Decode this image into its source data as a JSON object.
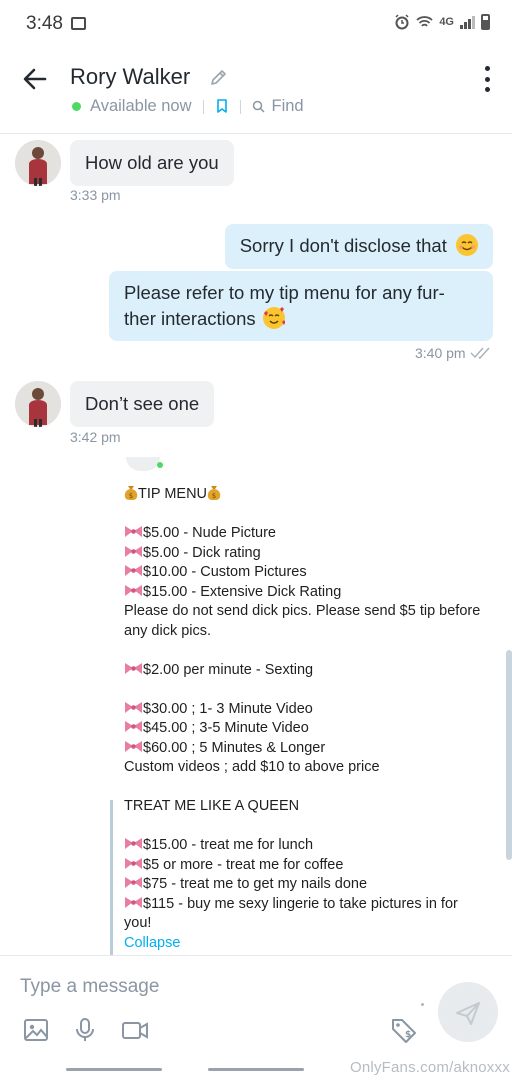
{
  "status_bar": {
    "time": "3:48",
    "network": "4G"
  },
  "header": {
    "name": "Rory Walker",
    "status": "Available now",
    "find_label": "Find"
  },
  "messages": [
    {
      "direction": "incoming",
      "text": "How old are you",
      "time": "3:33 pm"
    },
    {
      "direction": "outgoing",
      "text": "Sorry I don't disclose that"
    },
    {
      "direction": "outgoing",
      "line1": "Please refer to my tip menu for any fur-",
      "line2": "ther interactions",
      "time": "3:40 pm"
    },
    {
      "direction": "incoming",
      "text": "Don’t see one",
      "time": "3:42 pm"
    }
  ],
  "tip_menu": {
    "title": "TIP MENU",
    "items_1": [
      "$5.00 - Nude Picture",
      "$5.00 - Dick rating",
      "$10.00 - Custom Pictures",
      "$15.00 - Extensive Dick Rating"
    ],
    "note_line1": "Please do not send dick pics. Please send $5 tip before",
    "note_line2": "any dick pics.",
    "items_2": [
      "$2.00 per minute - Sexting"
    ],
    "items_3": [
      "$30.00 ; 1- 3 Minute Video",
      "$45.00 ; 3-5 Minute Video",
      "$60.00 ; 5 Minutes & Longer"
    ],
    "custom_note": "Custom videos ; add $10 to above price",
    "queen_heading": "TREAT ME LIKE A QUEEN",
    "items_4": [
      "$15.00 - treat me for lunch",
      "$5 or more - treat me for coffee",
      "$75 - treat me to get my nails done",
      "$115 - buy me sexy lingerie to take pictures in for"
    ],
    "last_wrap": "you!",
    "collapse_label": "Collapse"
  },
  "composer": {
    "placeholder": "Type a message"
  },
  "watermark": "OnlyFans.com/aknoxxx",
  "colors": {
    "accent": "#00aff0",
    "outgoing_bubble": "#dcf0fb",
    "incoming_bubble": "#f0f1f2",
    "online": "#4cd964"
  }
}
